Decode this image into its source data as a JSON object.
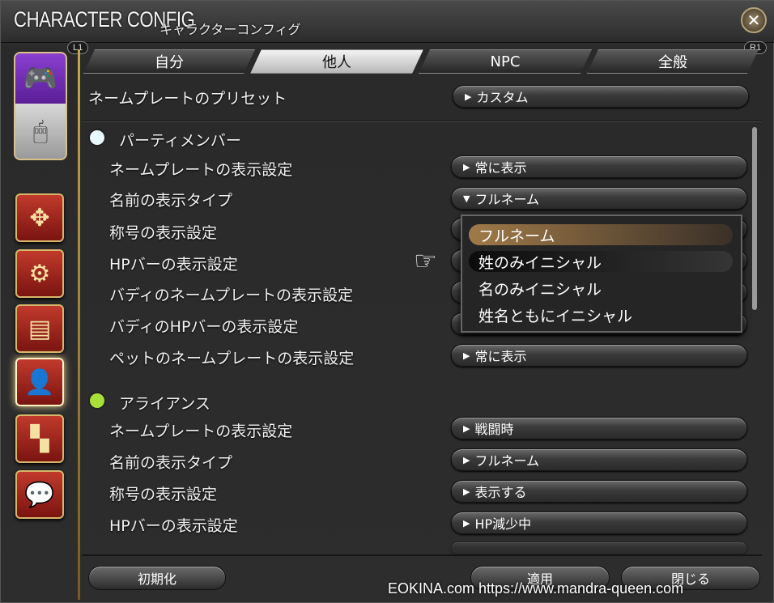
{
  "window": {
    "title": "CHARACTER CONFIG",
    "subtitle": "キャラクターコンフィグ",
    "close_icon": "close-cross-icon",
    "l1": "L1",
    "r1": "R1"
  },
  "side": {
    "mode_top_icon": "gamepad-icon",
    "mode_bottom_icon": "mouse-icon",
    "icons": [
      "arrows-icon",
      "gear-bag-icon",
      "id-card-icon",
      "nameplate-person-icon",
      "checker-flag-icon",
      "chat-bubble-icon"
    ]
  },
  "tabs": [
    "自分",
    "他人",
    "NPC",
    "全般"
  ],
  "preset": {
    "label": "ネームプレートのプリセット",
    "value": "カスタム"
  },
  "party": {
    "title": "パーティメンバー",
    "color": "#e8f8ff",
    "rows": [
      {
        "label": "ネームプレートの表示設定",
        "value": "常に表示"
      },
      {
        "label": "名前の表示タイプ",
        "value": "フルネーム"
      },
      {
        "label": "称号の表示設定",
        "value": ""
      },
      {
        "label": "HPバーの表示設定",
        "value": ""
      },
      {
        "label": "バディのネームプレートの表示設定",
        "value": ""
      },
      {
        "label": "バディのHPバーの表示設定",
        "value": ""
      },
      {
        "label": "ペットのネームプレートの表示設定",
        "value": "常に表示"
      }
    ]
  },
  "dropdown": {
    "options": [
      "フルネーム",
      "姓のみイニシャル",
      "名のみイニシャル",
      "姓名ともにイニシャル"
    ],
    "selected": 0,
    "hovered": 1,
    "pointer_icon": "pointing-hand-icon"
  },
  "alliance": {
    "title": "アライアンス",
    "color": "#a8e03a",
    "rows": [
      {
        "label": "ネームプレートの表示設定",
        "value": "戦闘時"
      },
      {
        "label": "名前の表示タイプ",
        "value": "フルネーム"
      },
      {
        "label": "称号の表示設定",
        "value": "表示する"
      },
      {
        "label": "HPバーの表示設定",
        "value": "HP減少中"
      }
    ]
  },
  "buttons": {
    "reset": "初期化",
    "apply": "適用",
    "close": "閉じる"
  },
  "watermark": "EOKINA.com  https://www.mandra-queen.com"
}
